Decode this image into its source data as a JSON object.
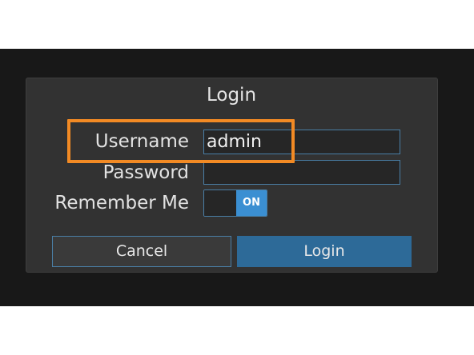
{
  "dialog": {
    "title": "Login",
    "username": {
      "label": "Username",
      "value": "admin"
    },
    "password": {
      "label": "Password",
      "value": ""
    },
    "remember_me": {
      "label": "Remember Me",
      "state_label": "ON",
      "checked": true
    },
    "buttons": {
      "cancel_label": "Cancel",
      "login_label": "Login"
    }
  },
  "colors": {
    "backdrop": "#181818",
    "dialog_bg": "#323232",
    "accent": "#3b8fd2",
    "primary_button": "#2d6a98",
    "highlight": "#f28a24"
  }
}
